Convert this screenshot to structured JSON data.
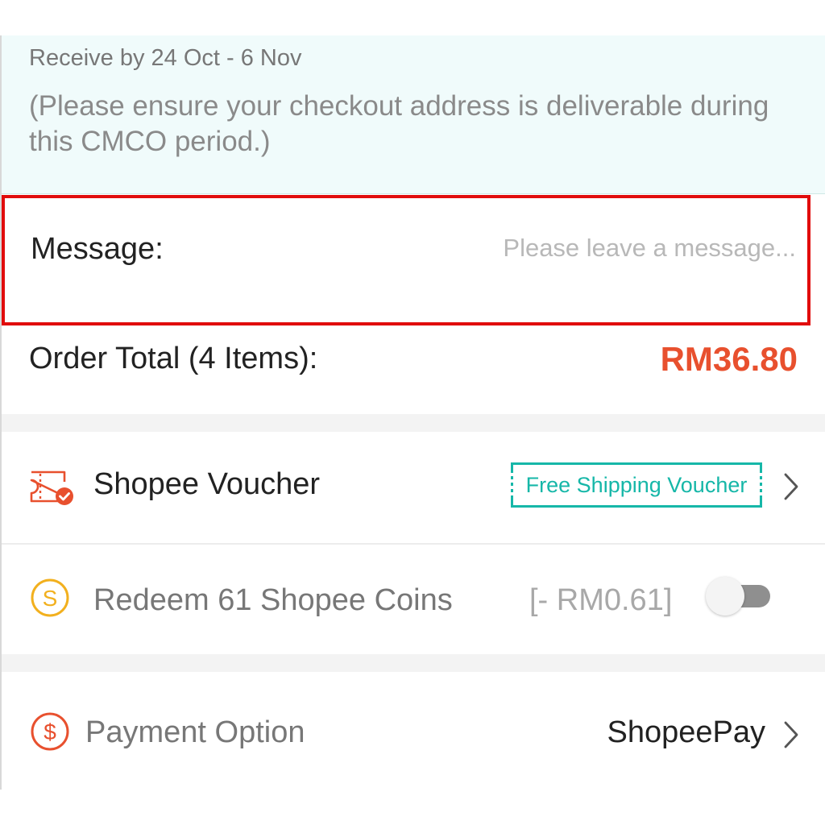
{
  "delivery": {
    "receive_text": "Receive by 24 Oct - 6 Nov",
    "note": "(Please ensure your checkout address is deliverable during this CMCO period.)"
  },
  "message": {
    "label": "Message:",
    "placeholder": "Please leave a message..."
  },
  "order_total": {
    "label": "Order Total (4 Items):",
    "amount": "RM36.80"
  },
  "voucher": {
    "label": "Shopee Voucher",
    "badge": "Free Shipping Voucher",
    "icon": "voucher-ticket-icon"
  },
  "coins": {
    "label": "Redeem 61 Shopee Coins",
    "value": "[- RM0.61]",
    "icon": "coin-icon",
    "enabled": false
  },
  "payment": {
    "label": "Payment Option",
    "value": "ShopeePay",
    "icon": "dollar-icon"
  },
  "colors": {
    "price": "#e8502e",
    "teal": "#16b7a8",
    "highlight_border": "#e10c0c",
    "coin": "#f2b01e"
  }
}
